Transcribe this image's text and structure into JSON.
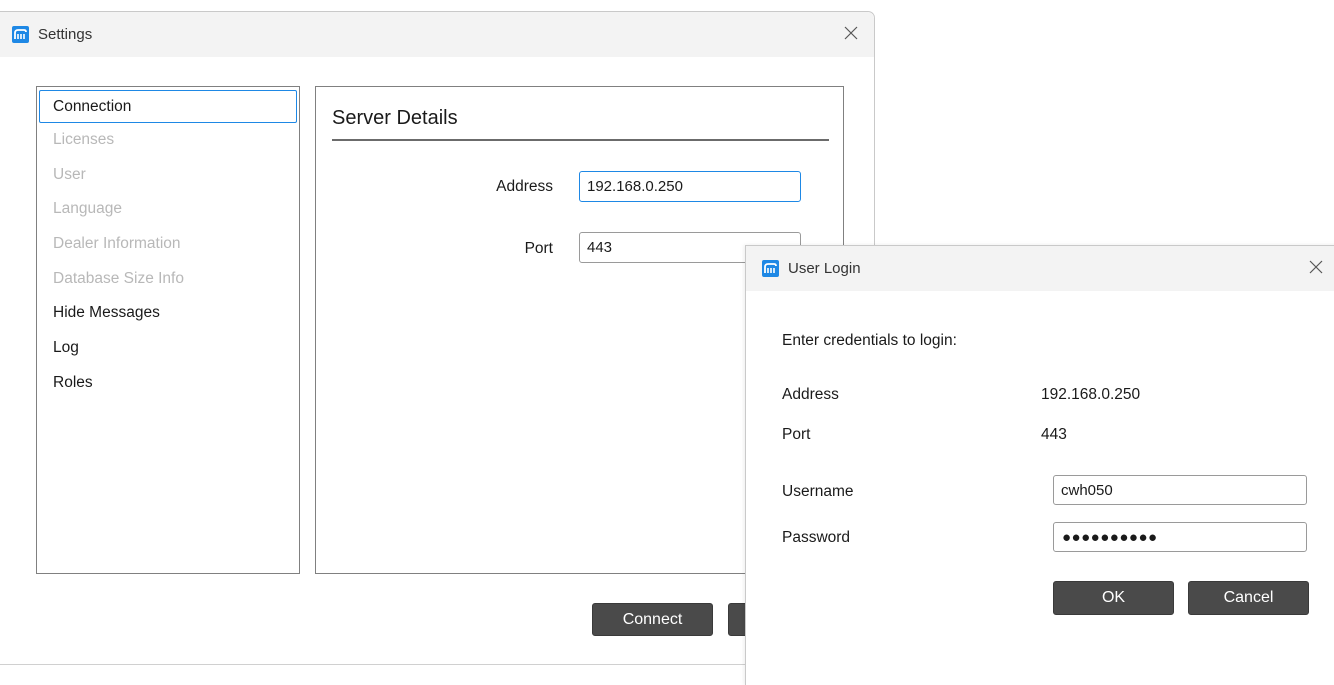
{
  "settings_window": {
    "title": "Settings",
    "nav_items": [
      {
        "label": "Connection",
        "state": "selected"
      },
      {
        "label": "Licenses",
        "state": "disabled"
      },
      {
        "label": "User",
        "state": "disabled"
      },
      {
        "label": "Language",
        "state": "disabled"
      },
      {
        "label": "Dealer Information",
        "state": "disabled"
      },
      {
        "label": "Database Size Info",
        "state": "disabled"
      },
      {
        "label": "Hide Messages",
        "state": "enabled"
      },
      {
        "label": "Log",
        "state": "enabled"
      },
      {
        "label": "Roles",
        "state": "enabled"
      }
    ],
    "section_title": "Server Details",
    "address_label": "Address",
    "address_value": "192.168.0.250",
    "port_label": "Port",
    "port_value": "443",
    "connect_label": "Connect"
  },
  "login_dialog": {
    "title": "User Login",
    "prompt": "Enter credentials to login:",
    "address_label": "Address",
    "address_value": "192.168.0.250",
    "port_label": "Port",
    "port_value": "443",
    "username_label": "Username",
    "username_value": "cwh050",
    "password_label": "Password",
    "password_mask": "●●●●●●●●●●",
    "ok_label": "OK",
    "cancel_label": "Cancel"
  },
  "colors": {
    "accent": "#1e88e5",
    "button_bg": "#4a4a4a",
    "disabled_text": "#b8b8b8"
  }
}
